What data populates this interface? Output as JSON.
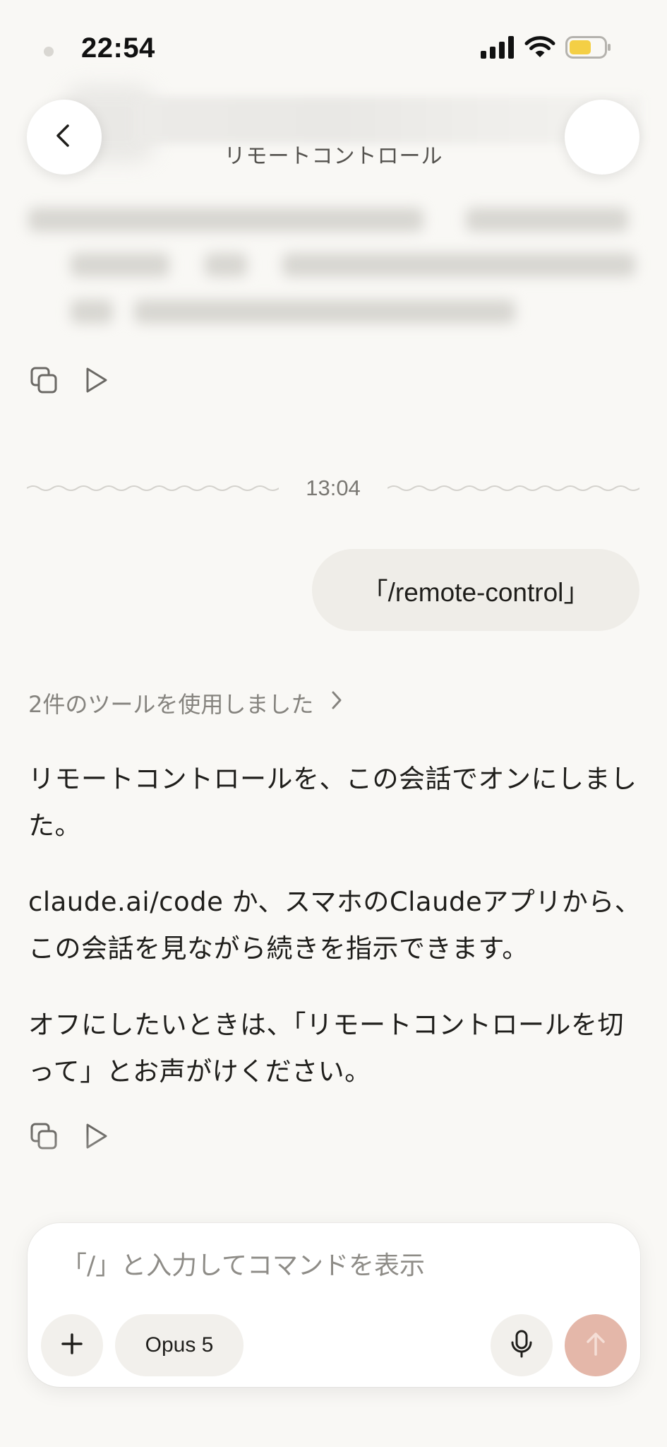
{
  "status_bar": {
    "time": "22:54",
    "battery_color": "#f4cf45"
  },
  "header": {
    "title": "リモートコントロール",
    "back_icon": "chevron-left-icon"
  },
  "previous_message": {
    "actions": {
      "copy_icon": "copy-icon",
      "play_icon": "play-icon"
    }
  },
  "divider": {
    "time": "13:04"
  },
  "user_message": {
    "text": "「/remote-control」"
  },
  "assistant_message": {
    "tool_summary": "2件のツールを使用しました",
    "paragraphs": [
      "リモートコントロールを、この会話でオンにしました。",
      "claude.ai/code か、スマホのClaudeアプリから、この会話を見ながら続きを指示できます。",
      "オフにしたいときは、「リモートコントロールを切って」とお声がけください。"
    ]
  },
  "composer": {
    "placeholder": "「/」と入力してコマンドを表示",
    "model_label": "Opus 5",
    "send_color": "#e4b7a9"
  },
  "colors": {
    "background": "#f9f8f5",
    "bubble": "#efede8",
    "muted_text": "#85837e"
  }
}
